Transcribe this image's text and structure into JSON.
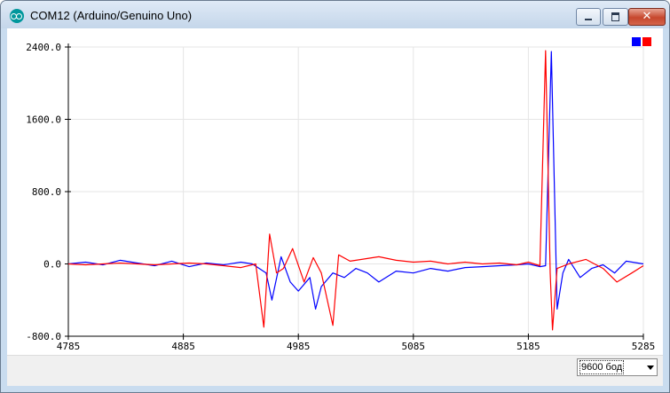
{
  "window": {
    "title": "COM12 (Arduino/Genuino Uno)",
    "icon": "arduino-icon",
    "controls": [
      "minimize-icon",
      "maximize-icon",
      "close-icon"
    ]
  },
  "baud": {
    "selected": "9600 бод"
  },
  "colors": {
    "series_blue": "#0000ff",
    "series_red": "#ff0000",
    "grid": "#e5e5e5"
  },
  "chart_data": {
    "type": "line",
    "title": "",
    "xlabel": "",
    "ylabel": "",
    "xlim": [
      4785,
      5285
    ],
    "ylim": [
      -800,
      2400
    ],
    "xticks": [
      "4785",
      "4885",
      "4985",
      "5085",
      "5185",
      "5285"
    ],
    "yticks": [
      "-800.0",
      "0.0",
      "800.0",
      "1600.0",
      "2400.0"
    ],
    "grid": true,
    "legend": "top-right",
    "series": [
      {
        "color": "#0000ff",
        "x": [
          4785,
          4800,
          4815,
          4830,
          4845,
          4860,
          4875,
          4890,
          4905,
          4920,
          4935,
          4945,
          4957,
          4962,
          4970,
          4978,
          4985,
          4995,
          5000,
          5005,
          5015,
          5025,
          5035,
          5045,
          5055,
          5070,
          5085,
          5100,
          5115,
          5130,
          5145,
          5160,
          5175,
          5185,
          5195,
          5200,
          5205,
          5210,
          5215,
          5220,
          5230,
          5240,
          5250,
          5260,
          5270,
          5285
        ],
        "y": [
          0,
          20,
          -10,
          40,
          10,
          -20,
          30,
          -30,
          10,
          -10,
          20,
          0,
          -100,
          -400,
          80,
          -200,
          -300,
          -150,
          -500,
          -250,
          -100,
          -150,
          -50,
          -100,
          -200,
          -80,
          -100,
          -50,
          -80,
          -40,
          -30,
          -20,
          -10,
          0,
          -30,
          -20,
          2350,
          -500,
          -100,
          50,
          -150,
          -50,
          -10,
          -100,
          30,
          0
        ]
      },
      {
        "color": "#ff0000",
        "x": [
          4785,
          4800,
          4815,
          4830,
          4845,
          4860,
          4875,
          4890,
          4905,
          4920,
          4935,
          4948,
          4955,
          4960,
          4966,
          4972,
          4980,
          4990,
          4998,
          5005,
          5015,
          5020,
          5030,
          5040,
          5055,
          5070,
          5085,
          5100,
          5115,
          5130,
          5145,
          5160,
          5175,
          5185,
          5195,
          5200,
          5204,
          5206,
          5210,
          5220,
          5235,
          5250,
          5262,
          5275,
          5285
        ],
        "y": [
          0,
          -10,
          0,
          10,
          0,
          -10,
          0,
          10,
          0,
          -20,
          -40,
          0,
          -700,
          330,
          -100,
          -50,
          170,
          -200,
          70,
          -100,
          -680,
          100,
          30,
          50,
          80,
          40,
          20,
          30,
          0,
          20,
          0,
          10,
          -10,
          20,
          -20,
          2360,
          -100,
          -730,
          -50,
          0,
          50,
          -50,
          -200,
          -100,
          -20
        ]
      }
    ]
  }
}
